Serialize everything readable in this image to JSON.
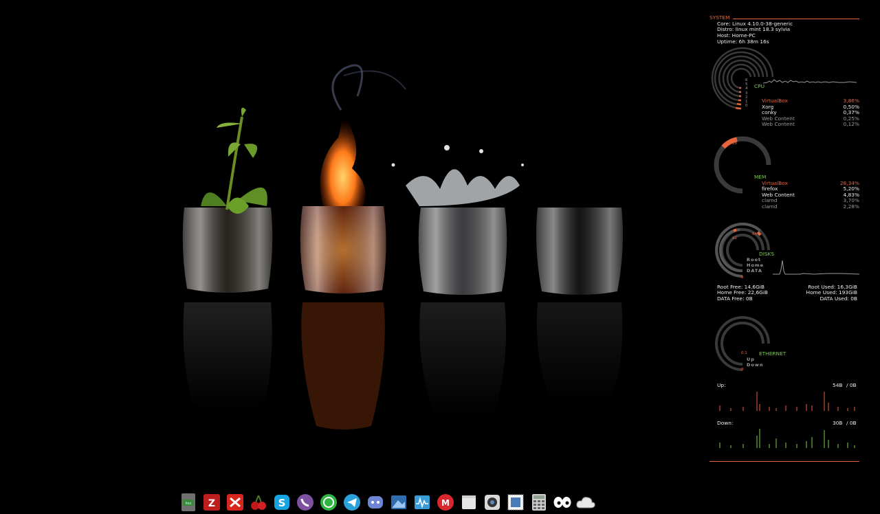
{
  "colors": {
    "accent": "#e8643c",
    "green": "#7ccb4a",
    "background": "#000000"
  },
  "wallpaper": {
    "subject": "four elements in glasses: plant, fire, water, air"
  },
  "conky": {
    "system": {
      "title": "SYSTEM",
      "core": "Core: Linux 4.10.0-38-generic",
      "distro": "Distro: linux mint 18.3 sylvia",
      "host": "Host: Home-PC",
      "uptime": "Uptime: 6h 38m 16s"
    },
    "cpu": {
      "label": "CPU",
      "ring_labels": [
        "6",
        "5",
        "4",
        "3",
        "2",
        "1",
        "0"
      ],
      "processes": [
        {
          "name": "VirtualBox",
          "value": "3,86%"
        },
        {
          "name": "Xorg",
          "value": "0,50%"
        },
        {
          "name": "conky",
          "value": "0,37%"
        },
        {
          "name": "Web Content",
          "value": "0,25%"
        },
        {
          "name": "Web Content",
          "value": "0,12%"
        }
      ]
    },
    "mem": {
      "label": "MEM",
      "ring_value": "18",
      "ring_fraction": 0.18,
      "processes": [
        {
          "name": "VirtualBox",
          "value": "28,34%"
        },
        {
          "name": "firefox",
          "value": "5,20%"
        },
        {
          "name": "Web Content",
          "value": "4,83%"
        },
        {
          "name": "clamd",
          "value": "3,70%"
        },
        {
          "name": "clamd",
          "value": "2,28%"
        }
      ]
    },
    "disks": {
      "label": "DISKS",
      "ring_values": [
        "64",
        "92",
        "0"
      ],
      "names": [
        "Root",
        "Home",
        "DATA"
      ],
      "root_free": "Root Free: 14,6GiB",
      "home_free": "Home Free: 22,6GiB",
      "data_free": "DATA Free: 0B",
      "root_used": "Root Used: 16,3GiB",
      "home_used": "Home Used: 193GiB",
      "data_used": "DATA Used: 0B"
    },
    "ethernet": {
      "label": "ETHERNET",
      "ring_values": [
        "0.1",
        "0"
      ],
      "names": [
        "Up",
        "Down"
      ],
      "up_label": "Up:",
      "up_value": "54B",
      "up_total": "/ 0B",
      "down_label": "Down:",
      "down_value": "30B",
      "down_total": "/ 0B"
    }
  },
  "dock": {
    "apps": [
      {
        "name": "hex-editor",
        "icon": "green-screen-icon"
      },
      {
        "name": "filezilla",
        "icon": "fz-icon"
      },
      {
        "name": "xmind",
        "icon": "x-icon"
      },
      {
        "name": "cherrytree",
        "icon": "cherry-icon"
      },
      {
        "name": "skype",
        "icon": "skype-icon"
      },
      {
        "name": "viber",
        "icon": "viber-icon"
      },
      {
        "name": "whatsapp",
        "icon": "whatsapp-icon"
      },
      {
        "name": "telegram",
        "icon": "telegram-icon"
      },
      {
        "name": "discord",
        "icon": "discord-icon"
      },
      {
        "name": "image-viewer",
        "icon": "image-icon"
      },
      {
        "name": "system-monitor",
        "icon": "monitor-icon"
      },
      {
        "name": "mega",
        "icon": "mega-icon"
      },
      {
        "name": "notes",
        "icon": "note-icon"
      },
      {
        "name": "camera",
        "icon": "camera-icon"
      },
      {
        "name": "photo-app",
        "icon": "stamp-icon"
      },
      {
        "name": "calculator",
        "icon": "calculator-icon"
      },
      {
        "name": "eyes",
        "icon": "eyes-icon"
      },
      {
        "name": "weather",
        "icon": "cloud-icon"
      }
    ]
  }
}
